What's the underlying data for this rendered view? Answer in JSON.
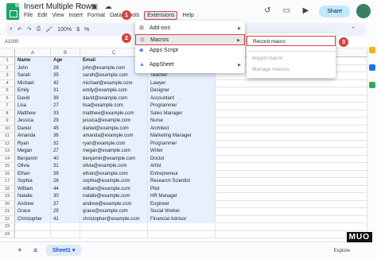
{
  "document": {
    "title": "Insert Multiple Rows",
    "title_icons": "☆ ▣ ☁"
  },
  "menubar": [
    "File",
    "Edit",
    "View",
    "Insert",
    "Format",
    "Data",
    "Tools",
    "Extensions",
    "Help"
  ],
  "share_label": "Share",
  "toolbar": {
    "undo": "↶",
    "redo": "↷",
    "print": "⎙",
    "paint": "🖌",
    "zoom": "100%",
    "currency": "$",
    "percent": "%",
    "collapse": "⌃"
  },
  "formula_bar": {
    "name_box": "A1000"
  },
  "columns": [
    "A",
    "B",
    "C"
  ],
  "header_row": [
    "Name",
    "Age",
    "Email"
  ],
  "rows": [
    {
      "n": "1",
      "name": "Name",
      "age": "Age",
      "email": "Email",
      "job": ""
    },
    {
      "n": "2",
      "name": "John",
      "age": "28",
      "email": "john@example.com",
      "job": "Engineer"
    },
    {
      "n": "3",
      "name": "Sarah",
      "age": "35",
      "email": "sarah@example.com",
      "job": "Teacher"
    },
    {
      "n": "4",
      "name": "Michael",
      "age": "42",
      "email": "michael@example.com",
      "job": "Lawyer"
    },
    {
      "n": "5",
      "name": "Emily",
      "age": "31",
      "email": "emily@example.com",
      "job": "Designer"
    },
    {
      "n": "6",
      "name": "David",
      "age": "39",
      "email": "david@example.com",
      "job": "Accountant"
    },
    {
      "n": "7",
      "name": "Lisa",
      "age": "27",
      "email": "lisa@example.com",
      "job": "Programmer"
    },
    {
      "n": "8",
      "name": "Matthew",
      "age": "33",
      "email": "matthew@example.com",
      "job": "Sales Manager"
    },
    {
      "n": "9",
      "name": "Jessica",
      "age": "29",
      "email": "jessica@example.com",
      "job": "Nurse"
    },
    {
      "n": "10",
      "name": "Daniel",
      "age": "45",
      "email": "daniel@example.com",
      "job": "Architect"
    },
    {
      "n": "11",
      "name": "Amanda",
      "age": "36",
      "email": "amanda@example.com",
      "job": "Marketing Manager"
    },
    {
      "n": "12",
      "name": "Ryan",
      "age": "32",
      "email": "ryan@example.com",
      "job": "Programmer"
    },
    {
      "n": "13",
      "name": "Megan",
      "age": "27",
      "email": "megan@example.com",
      "job": "Writer"
    },
    {
      "n": "14",
      "name": "Benjamin",
      "age": "40",
      "email": "benjamin@example.com",
      "job": "Doctor"
    },
    {
      "n": "15",
      "name": "Olivia",
      "age": "31",
      "email": "olivia@example.com",
      "job": "Artist"
    },
    {
      "n": "16",
      "name": "Ethan",
      "age": "38",
      "email": "ethan@example.com",
      "job": "Entrepreneur"
    },
    {
      "n": "17",
      "name": "Sophia",
      "age": "26",
      "email": "sophia@example.com",
      "job": "Research Scientist"
    },
    {
      "n": "18",
      "name": "William",
      "age": "44",
      "email": "william@example.com",
      "job": "Pilot"
    },
    {
      "n": "19",
      "name": "Natalie",
      "age": "30",
      "email": "natalie@example.com",
      "job": "HR Manager"
    },
    {
      "n": "20",
      "name": "Andrew",
      "age": "37",
      "email": "andrew@example.com",
      "job": "Engineer"
    },
    {
      "n": "21",
      "name": "Grace",
      "age": "29",
      "email": "grace@example.com",
      "job": "Social Worker"
    },
    {
      "n": "22",
      "name": "Christopher",
      "age": "41",
      "email": "christopher@example.com",
      "job": "Financial Advisor"
    },
    {
      "n": "23",
      "name": "",
      "age": "",
      "email": "",
      "job": ""
    },
    {
      "n": "24",
      "name": "",
      "age": "",
      "email": "",
      "job": ""
    }
  ],
  "extensions_menu": {
    "items": [
      {
        "label": "Add-ons",
        "icon": "⊞",
        "arrow": "▶"
      },
      {
        "label": "Macros",
        "icon": "⊙",
        "arrow": "▶"
      },
      {
        "label": "Apps Script",
        "icon": "◆",
        "arrow": ""
      },
      {
        "label": "AppSheet",
        "icon": "▲",
        "arrow": "▶"
      }
    ]
  },
  "macros_submenu": {
    "items": [
      {
        "label": "Record macro"
      },
      {
        "label": "Import macro"
      },
      {
        "label": "Manage macros"
      }
    ]
  },
  "badges": [
    "1",
    "2",
    "3"
  ],
  "bottom": {
    "add_sheet": "+",
    "all_sheets": "≡",
    "sheet_tab": "Sheet1 ▾",
    "explore": "Explore"
  },
  "watermark": "MUO",
  "colors": {
    "accent_red": "#d64541",
    "selection": "#e8f0fe",
    "share": "#c2e7ff",
    "sheets_green": "#1ea362"
  }
}
